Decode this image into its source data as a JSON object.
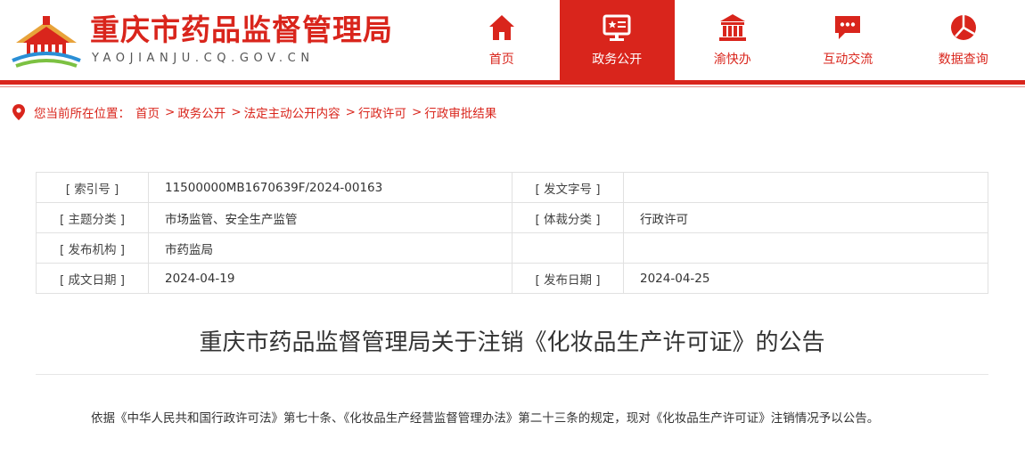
{
  "header": {
    "site_title": "重庆市药品监督管理局",
    "site_domain": "YAOJIANJU.CQ.GOV.CN",
    "logo_icon": "building-logo-icon",
    "brand_color": "#d9251c"
  },
  "nav": {
    "items": [
      {
        "label": "首页",
        "icon": "home-icon",
        "active": false
      },
      {
        "label": "政务公开",
        "icon": "board-icon",
        "active": true
      },
      {
        "label": "渝快办",
        "icon": "government-building-icon",
        "active": false
      },
      {
        "label": "互动交流",
        "icon": "chat-icon",
        "active": false
      },
      {
        "label": "数据查询",
        "icon": "pie-chart-icon",
        "active": false
      }
    ]
  },
  "breadcrumb": {
    "prefix": "您当前所在位置：",
    "items": [
      "首页",
      "政务公开",
      "法定主动公开内容",
      "行政许可",
      "行政审批结果"
    ],
    "separator": ">"
  },
  "info": {
    "index_label": "[ 索引号 ]",
    "index_value": "11500000MB1670639F/2024-00163",
    "doc_no_label": "[ 发文字号 ]",
    "doc_no_value": "",
    "topic_label": "[ 主题分类 ]",
    "topic_value": "市场监管、安全生产监管",
    "genre_label": "[ 体裁分类 ]",
    "genre_value": "行政许可",
    "org_label": "[ 发布机构 ]",
    "org_value": "市药监局",
    "created_label": "[ 成文日期 ]",
    "created_value": "2024-04-19",
    "published_label": "[ 发布日期 ]",
    "published_value": "2024-04-25"
  },
  "document": {
    "title": "重庆市药品监督管理局关于注销《化妆品生产许可证》的公告",
    "body": "依据《中华人民共和国行政许可法》第七十条、《化妆品生产经营监督管理办法》第二十三条的规定，现对《化妆品生产许可证》注销情况予以公告。"
  }
}
